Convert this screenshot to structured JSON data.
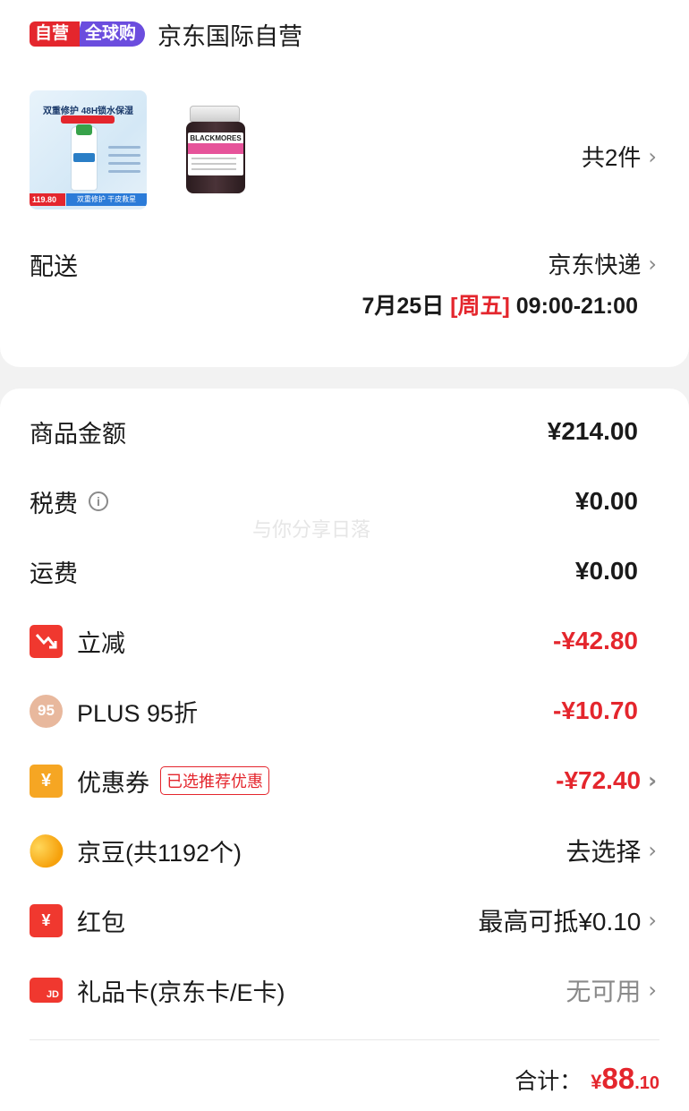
{
  "store": {
    "badge_self": "自营",
    "badge_global": "全球购",
    "name": "京东国际自营"
  },
  "products": {
    "item1_headline": "双重修护 48H锁水保湿",
    "item1_price": "119.80",
    "item1_strip": "双重修护 干皮救星",
    "item2_brand": "BLACKMORES",
    "count_label": "共2件"
  },
  "delivery": {
    "label": "配送",
    "carrier": "京东快递",
    "date": "7月25日",
    "weekday": "[周五]",
    "time": "09:00-21:00"
  },
  "summary": {
    "goods_label": "商品金额",
    "goods_value": "¥214.00",
    "tax_label": "税费",
    "tax_value": "¥0.00",
    "shipping_label": "运费",
    "shipping_value": "¥0.00",
    "discount_label": "立减",
    "discount_value": "-¥42.80",
    "plus_icon_text": "95",
    "plus_label": "PLUS 95折",
    "plus_value": "-¥10.70",
    "coupon_icon_text": "¥",
    "coupon_label": "优惠券",
    "coupon_tag": "已选推荐优惠",
    "coupon_value": "-¥72.40",
    "beans_label": "京豆(共1192个)",
    "beans_value": "去选择",
    "redpacket_icon_text": "¥",
    "redpacket_label": "红包",
    "redpacket_value": "最高可抵¥0.10",
    "giftcard_icon_text": "JD",
    "giftcard_label": "礼品卡(京东卡/E卡)",
    "giftcard_value": "无可用"
  },
  "total": {
    "label": "合计：",
    "currency": "¥",
    "integer": "88",
    "decimal": ".10"
  },
  "watermark": "与你分享日落",
  "icons": {
    "chevron": "chevron-right-icon",
    "info": "info-icon"
  },
  "colors": {
    "accent_red": "#e4262d",
    "global_purple": "#6b4dde"
  }
}
